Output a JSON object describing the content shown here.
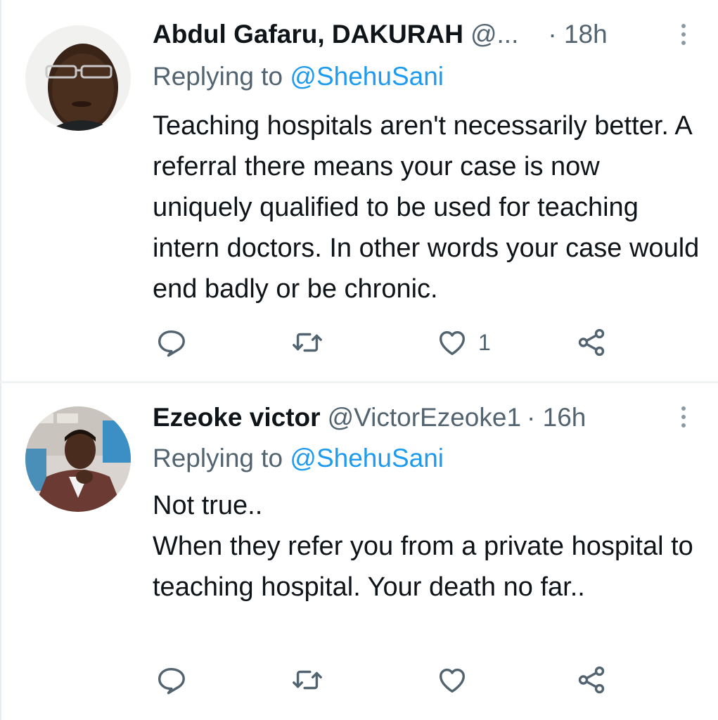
{
  "tweets": [
    {
      "author_name": "Abdul Gafaru, DAKURAH",
      "handle": "@...",
      "time": "· 18h",
      "replying_prefix": "Replying to",
      "replying_to": "@ShehuSani",
      "text": "Teaching hospitals aren't necessarily better. A referral there means your case is now uniquely qualified to be used for teaching intern doctors. In other words your case would end badly or be chronic.",
      "like_count": "1"
    },
    {
      "author_name": "Ezeoke victor",
      "handle": "@VictorEzeoke1",
      "time": "· 16h",
      "replying_prefix": "Replying to",
      "replying_to": "@ShehuSani",
      "text": "Not true..\nWhen they refer you from a private hospital to teaching hospital. Your death no far..",
      "like_count": ""
    }
  ],
  "icons": {
    "reply": "comment-bubble-icon",
    "retweet": "retweet-arrows-icon",
    "like": "heart-outline-icon",
    "share": "share-nodes-icon",
    "more": "vertical-dots-icon"
  },
  "colors": {
    "text": "#0f1419",
    "secondary": "#536471",
    "mention": "#1d9bf0"
  }
}
